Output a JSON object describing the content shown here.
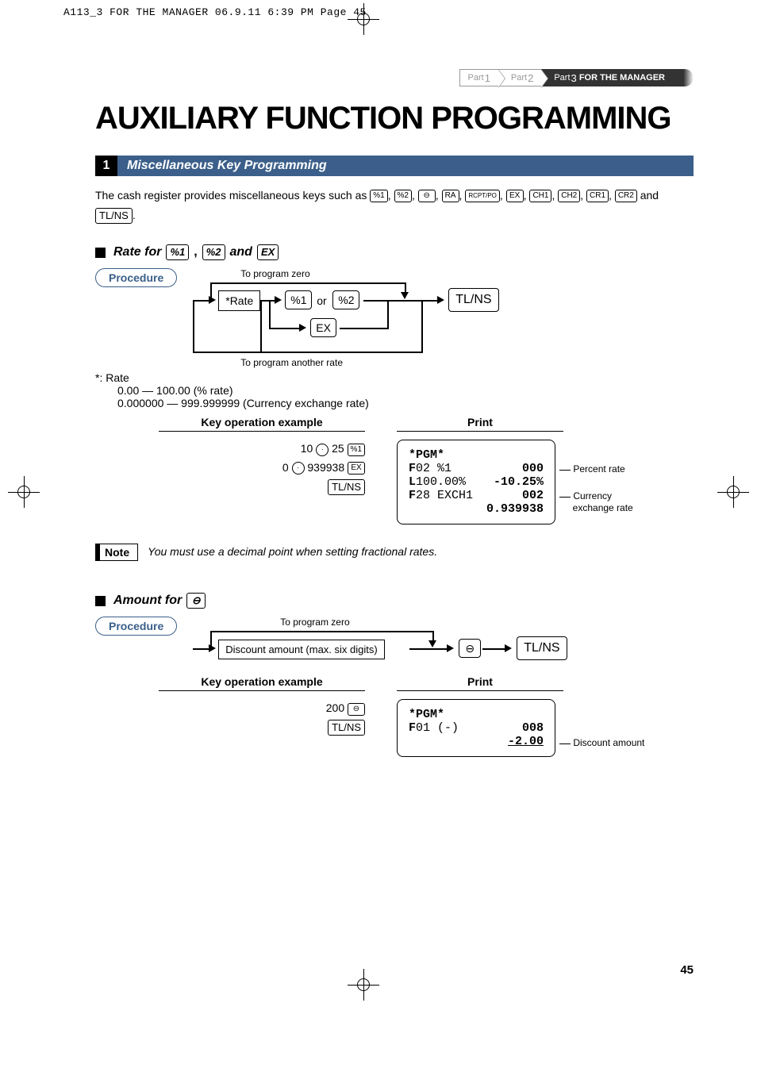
{
  "header": "A113_3 FOR THE MANAGER  06.9.11 6:39 PM  Page 45",
  "breadcrumb": {
    "p1": "Part",
    "n1": "1",
    "p2": "Part",
    "n2": "2",
    "p3": "Part",
    "n3": "3",
    "label": "FOR THE MANAGER"
  },
  "title": "AUXILIARY FUNCTION PROGRAMMING",
  "section": {
    "num": "1",
    "title": "Miscellaneous Key Programming"
  },
  "intro": {
    "pre": "The cash register provides miscellaneous keys such as ",
    "keys": [
      "%1",
      "%2",
      "⊖",
      "RA",
      "RCPT/PO",
      "EX",
      "CH1",
      "CH2",
      "CR1",
      "CR2"
    ],
    "mid": " and",
    "tail": "TL/NS",
    "end": "."
  },
  "rate": {
    "heading_pre": "Rate for ",
    "k1": "%1",
    "comma": ", ",
    "k2": "%2",
    "and": " and ",
    "k3": "EX",
    "procedure": "Procedure",
    "to_zero": "To program zero",
    "star_rate": "*Rate",
    "pct1": "%1",
    "or": "or",
    "pct2": "%2",
    "tlns": "TL/NS",
    "ex": "EX",
    "to_another": "To program another rate",
    "star": "*:  Rate",
    "line1": "0.00 — 100.00 (% rate)",
    "line2": "0.000000 — 999.999999 (Currency exchange rate)",
    "keyop_hdr": "Key operation example",
    "print_hdr": "Print",
    "keyop1_a": "10 ",
    "keyop1_dot": "·",
    "keyop1_b": " 25 ",
    "keyop1_key": "%1",
    "keyop2_a": "0 ",
    "keyop2_dot": "·",
    "keyop2_b": " 939938 ",
    "keyop2_key": "EX",
    "keyop3": "TL/NS",
    "receipt": {
      "l1a": "*PGM*",
      "l2a": "F02 %1",
      "l2b": "000",
      "l3a": "L100.00%",
      "l3b": "-10.25%",
      "l4a": "F28 EXCH1",
      "l4b": "002",
      "l5b": "0.939938"
    },
    "cl1": "Percent rate",
    "cl2a": "Currency",
    "cl2b": "exchange rate",
    "note_label": "Note",
    "note_text": "You must use a decimal point when setting fractional rates."
  },
  "amount": {
    "heading_pre": "Amount for ",
    "hkey": "⊖",
    "procedure": "Procedure",
    "to_zero": "To program zero",
    "box": "Discount amount (max. six digits)",
    "minus": "⊖",
    "tlns": "TL/NS",
    "keyop_hdr": "Key operation example",
    "print_hdr": "Print",
    "keyop1_a": "200 ",
    "keyop1_key": "⊖",
    "keyop2": "TL/NS",
    "receipt": {
      "l1a": "*PGM*",
      "l2a": "F01 (-)",
      "l2b": "008",
      "l3b": "-2.00"
    },
    "cl": "Discount amount"
  },
  "page": "45"
}
